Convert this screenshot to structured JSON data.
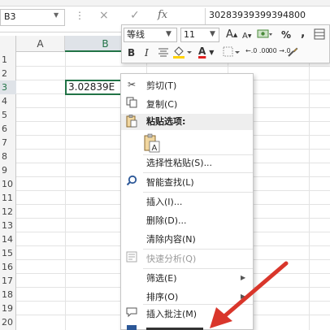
{
  "name_box": {
    "value": "B3"
  },
  "formula_bar": {
    "dots": "⋮",
    "cancel_icon": "×",
    "enter_icon": "✓",
    "fx_label": "fx",
    "value": "30283939399394800"
  },
  "columns": [
    "A",
    "B"
  ],
  "rows": [
    "1",
    "2",
    "3",
    "4",
    "5",
    "6",
    "7",
    "8",
    "9",
    "10",
    "11",
    "12",
    "13",
    "14",
    "15",
    "16",
    "17",
    "18",
    "19",
    "20"
  ],
  "selected_cell": {
    "display": "3.02839E"
  },
  "mini_toolbar": {
    "font_name": "等线",
    "font_size": "11",
    "grow_font": "A",
    "shrink_font": "A",
    "percent": "%",
    "comma": ",",
    "bold": "B",
    "italic": "I",
    "font_color_letter": "A",
    "inc_decimal": "←.0 .00",
    "dec_decimal": ".00 →.0"
  },
  "context_menu": {
    "cut": "剪切(T)",
    "copy": "复制(C)",
    "paste_options": "粘贴选项:",
    "paste_special": "选择性粘贴(S)...",
    "smart_lookup": "智能查找(L)",
    "insert": "插入(I)...",
    "delete": "删除(D)...",
    "clear_contents": "清除内容(N)",
    "quick_analysis": "快速分析(Q)",
    "filter": "筛选(E)",
    "sort": "排序(O)",
    "insert_comment": "插入批注(M)"
  },
  "colors": {
    "accent": "#217346",
    "arrow": "#d9362b"
  }
}
